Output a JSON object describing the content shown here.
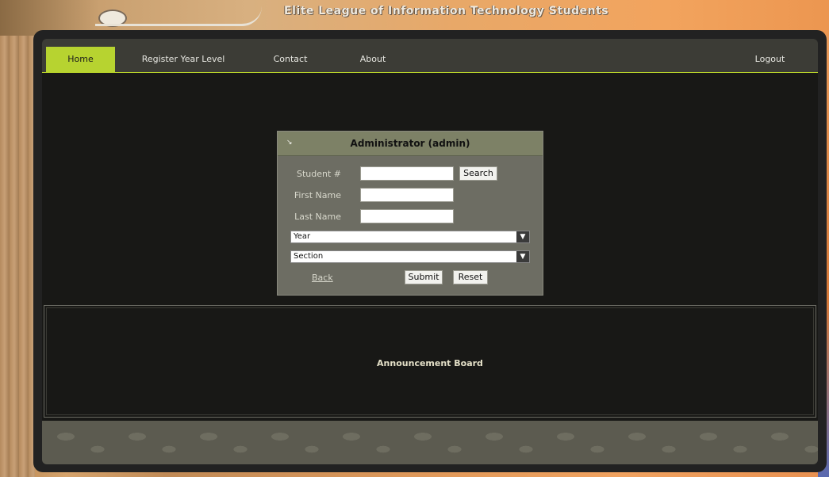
{
  "header": {
    "slogan": "Elite League of Information Technology Students"
  },
  "nav": {
    "items": [
      {
        "label": "Home",
        "active": true
      },
      {
        "label": "Register Year Level",
        "active": false
      },
      {
        "label": "Contact",
        "active": false
      },
      {
        "label": "About",
        "active": false
      },
      {
        "label": "Logout",
        "active": false
      }
    ]
  },
  "admin_form": {
    "title": "Administrator (admin)",
    "student_no_label": "Student #",
    "student_no_value": "",
    "search_label": "Search",
    "first_name_label": "First Name",
    "first_name_value": "",
    "last_name_label": "Last Name",
    "last_name_value": "",
    "year_select": "Year",
    "section_select": "Section",
    "back_label": "Back",
    "submit_label": "Submit",
    "reset_label": "Reset"
  },
  "announcement": {
    "title": "Announcement Board"
  },
  "colors": {
    "accent": "#b7d330",
    "panel_bg": "#181816",
    "form_bg": "#6d6d63",
    "form_header": "#7d8166"
  }
}
